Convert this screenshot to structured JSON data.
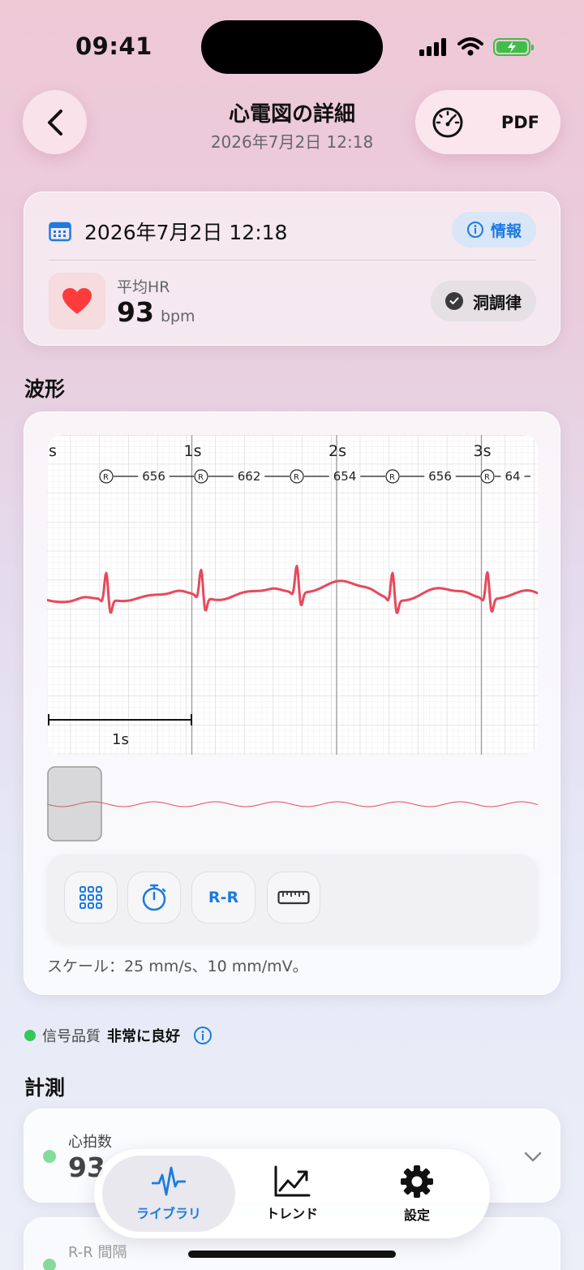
{
  "status_bar": {
    "time": "09:41"
  },
  "header": {
    "title": "心電図の詳細",
    "subtitle": "2026年7月2日 12:18",
    "pdf_label": "PDF"
  },
  "info_card": {
    "date": "2026年7月2日 12:18",
    "info_label": "情報",
    "hr_label": "平均HR",
    "hr_value": "93",
    "hr_unit": "bpm",
    "rhythm": "洞調律"
  },
  "waveform": {
    "section_title": "波形",
    "time_labels": [
      "s",
      "1s",
      "2s",
      "3s"
    ],
    "rr_marker": "R",
    "rr_intervals": [
      "656",
      "662",
      "654",
      "656",
      "64"
    ],
    "scale_bar_label": "1s",
    "tools": {
      "rr_label": "R-R"
    },
    "scale_text": "スケール：25 mm/s、10 mm/mV。"
  },
  "signal_quality": {
    "label": "信号品質",
    "value": "非常に良好"
  },
  "measurements": {
    "section_title": "計測",
    "items": [
      {
        "label": "心拍数",
        "value": "93"
      },
      {
        "label": "R-R 間隔",
        "value": ""
      }
    ]
  },
  "tabbar": {
    "tabs": [
      {
        "label": "ライブラリ"
      },
      {
        "label": "トレンド"
      },
      {
        "label": "設定"
      }
    ]
  },
  "colors": {
    "accent": "#1b7be0",
    "ecg": "#e8485c",
    "good": "#34c759"
  }
}
